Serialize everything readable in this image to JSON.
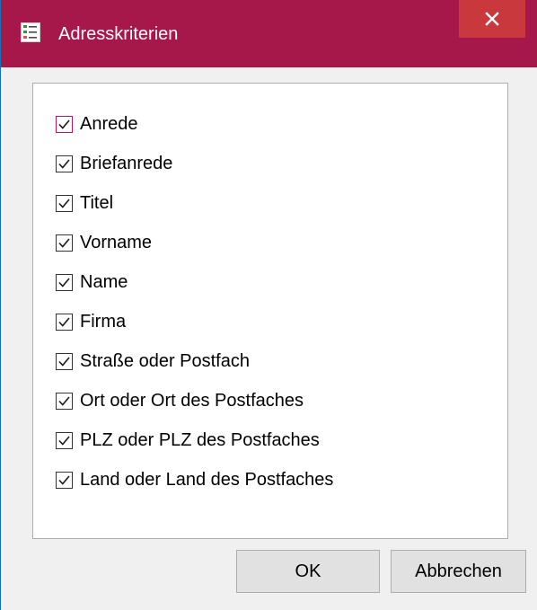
{
  "window": {
    "title": "Adresskriterien",
    "accent_color": "#a6184a",
    "close_color": "#c8383d",
    "close_icon": "close-icon",
    "app_icon": "checklist-app-icon"
  },
  "criteria": [
    {
      "label": "Anrede",
      "checked": true
    },
    {
      "label": "Briefanrede",
      "checked": true
    },
    {
      "label": "Titel",
      "checked": true
    },
    {
      "label": "Vorname",
      "checked": true
    },
    {
      "label": "Name",
      "checked": true
    },
    {
      "label": "Firma",
      "checked": true
    },
    {
      "label": "Straße oder Postfach",
      "checked": true
    },
    {
      "label": "Ort oder Ort des Postfaches",
      "checked": true
    },
    {
      "label": "PLZ oder PLZ des Postfaches",
      "checked": true
    },
    {
      "label": "Land oder Land des Postfaches",
      "checked": true
    }
  ],
  "buttons": {
    "ok_label": "OK",
    "cancel_label": "Abbrechen"
  }
}
